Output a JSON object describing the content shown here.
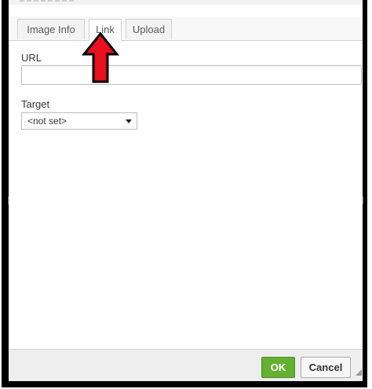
{
  "tabs": [
    {
      "label": "Image Info",
      "active": false
    },
    {
      "label": "Link",
      "active": true
    },
    {
      "label": "Upload",
      "active": false
    }
  ],
  "link_tab": {
    "url_label": "URL",
    "url_value": "",
    "target_label": "Target",
    "target_selected": "<not set>"
  },
  "footer": {
    "ok_label": "OK",
    "cancel_label": "Cancel"
  },
  "annotation": {
    "icon": "red-arrow-up-icon",
    "color": "#e8101a"
  },
  "colors": {
    "ok_green": "#64b031"
  }
}
